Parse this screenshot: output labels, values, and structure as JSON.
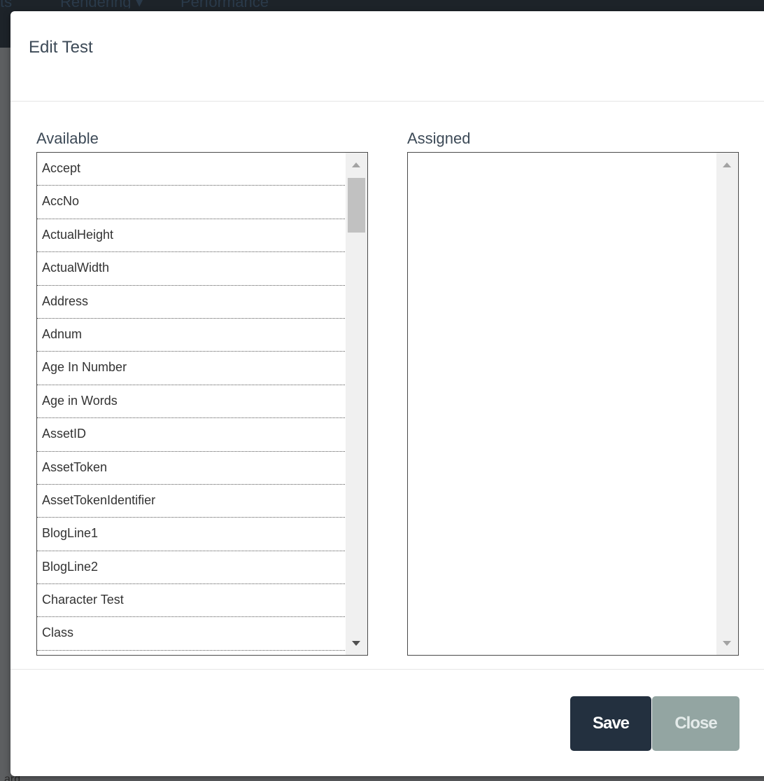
{
  "background": {
    "nav_items": [
      "ts",
      "Rendering ▾",
      "Performance"
    ],
    "footer_text": "ard"
  },
  "modal": {
    "title": "Edit Test",
    "available": {
      "label": "Available",
      "items": [
        "Accept",
        "AccNo",
        "ActualHeight",
        "ActualWidth",
        "Address",
        "Adnum",
        "Age In Number",
        "Age in Words",
        "AssetID",
        "AssetToken",
        "AssetTokenIdentifier",
        "BlogLine1",
        "BlogLine2",
        "Character Test",
        "Class"
      ]
    },
    "assigned": {
      "label": "Assigned",
      "items": []
    },
    "buttons": {
      "save": "Save",
      "close": "Close"
    }
  },
  "colors": {
    "save_bg": "#23303f",
    "close_bg": "#93a5a2",
    "overlay": "#5d5f61"
  },
  "icons": {
    "scroll_up": "scroll-up-arrow-icon",
    "scroll_down": "scroll-down-arrow-icon"
  }
}
